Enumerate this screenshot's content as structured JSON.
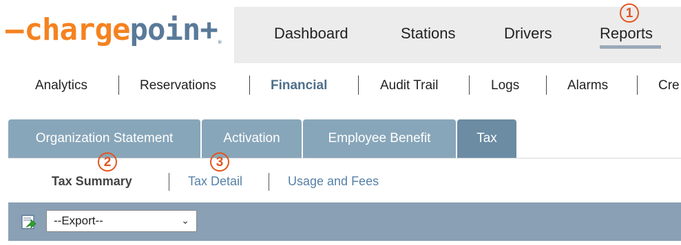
{
  "brand": {
    "dash": "–",
    "charge": "charge",
    "point": "poin+",
    "reg": "®"
  },
  "topnav": {
    "items": [
      "Dashboard",
      "Stations",
      "Drivers",
      "Reports"
    ],
    "active": "Reports"
  },
  "subnav": {
    "items": [
      "Analytics",
      "Reservations",
      "Financial",
      "Audit Trail",
      "Logs",
      "Alarms",
      "Cre"
    ],
    "active": "Financial"
  },
  "tabs": {
    "items": [
      "Organization Statement",
      "Activation",
      "Employee Benefit",
      "Tax"
    ],
    "active": "Tax"
  },
  "subtabs": {
    "items": [
      "Tax Summary",
      "Tax Detail",
      "Usage and Fees"
    ],
    "active": "Tax Summary"
  },
  "annotations": [
    "1",
    "2",
    "3"
  ],
  "export": {
    "selected": "--Export--",
    "icon": "export-icon"
  },
  "colors": {
    "brand_orange": "#f58220",
    "brand_slate": "#5a7a99",
    "annotation": "#e2551f",
    "tab": "#88a6ba",
    "tab_active": "#6b8ca3",
    "export_bar": "#8aa0b5"
  }
}
